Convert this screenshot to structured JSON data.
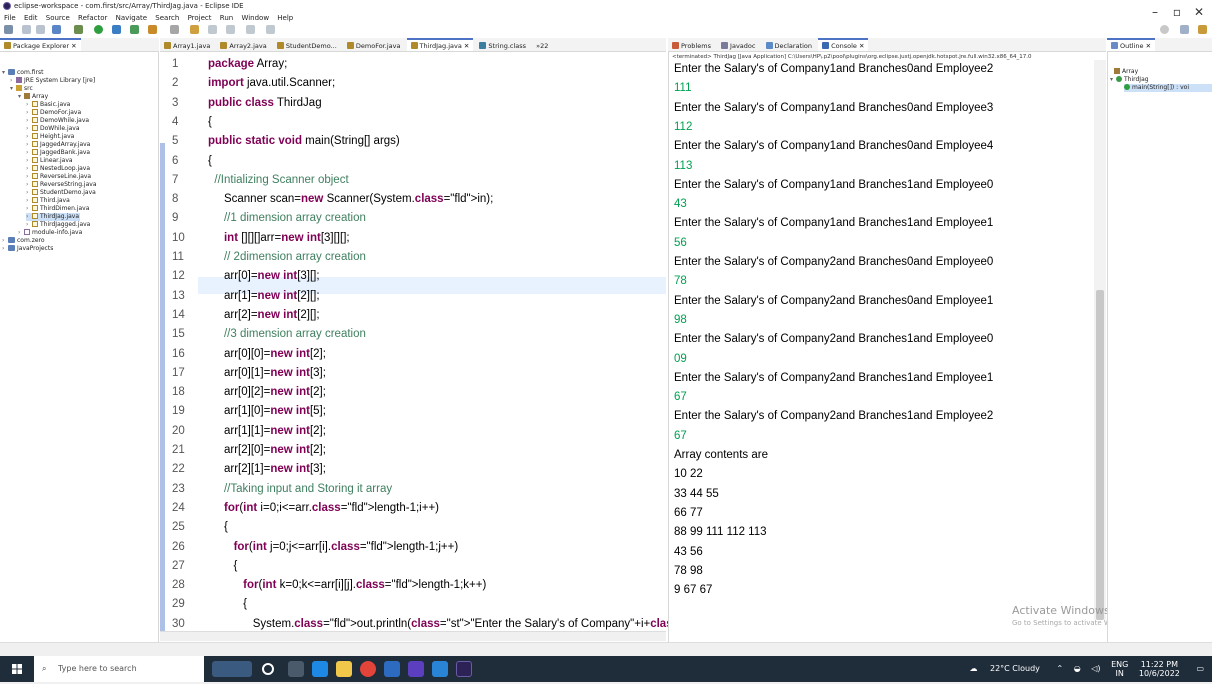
{
  "window": {
    "title": "eclipse-workspace - com.first/src/Array/ThirdJag.java - Eclipse IDE"
  },
  "menu": [
    "File",
    "Edit",
    "Source",
    "Refactor",
    "Navigate",
    "Search",
    "Project",
    "Run",
    "Window",
    "Help"
  ],
  "package_explorer": {
    "tab_label": "Package Explorer",
    "tree": [
      {
        "label": "com.first",
        "type": "project"
      },
      {
        "label": "JRE System Library [jre]",
        "type": "lib"
      },
      {
        "label": "src",
        "type": "folder"
      },
      {
        "label": "Array",
        "type": "package"
      },
      {
        "label": "Basic.java",
        "type": "file"
      },
      {
        "label": "DemoFor.java",
        "type": "file"
      },
      {
        "label": "DemoWhile.java",
        "type": "file"
      },
      {
        "label": "DoWhile.java",
        "type": "file"
      },
      {
        "label": "Height.java",
        "type": "file"
      },
      {
        "label": "JaggedArray.java",
        "type": "file"
      },
      {
        "label": "JaggedBank.java",
        "type": "file"
      },
      {
        "label": "Linear.java",
        "type": "file"
      },
      {
        "label": "NestedLoop.java",
        "type": "file"
      },
      {
        "label": "ReverseLine.java",
        "type": "file"
      },
      {
        "label": "ReverseString.java",
        "type": "file"
      },
      {
        "label": "StudentDemo.java",
        "type": "file"
      },
      {
        "label": "Third.java",
        "type": "file"
      },
      {
        "label": "ThirdDimen.java",
        "type": "file"
      },
      {
        "label": "ThirdJag.java",
        "type": "file"
      },
      {
        "label": "ThirdJagged.java",
        "type": "file"
      },
      {
        "label": "module-info.java",
        "type": "file"
      },
      {
        "label": "com.zero",
        "type": "project"
      },
      {
        "label": "JavaProjects",
        "type": "project"
      }
    ]
  },
  "editor": {
    "tabs": [
      "Array1.java",
      "Array2.java",
      "StudentDemo...",
      "DemoFor.java",
      "ThirdJag.java",
      "String.class"
    ],
    "overflow_count": "»22",
    "lines": [
      {
        "n": "1",
        "t": "package Array;"
      },
      {
        "n": "2",
        "t": "import java.util.Scanner;"
      },
      {
        "n": "3",
        "t": "public class ThirdJag"
      },
      {
        "n": "4",
        "t": "{"
      },
      {
        "n": "5",
        "t": "public static void main(String[] args)"
      },
      {
        "n": "6",
        "t": "{"
      },
      {
        "n": "7",
        "t": "  //Intializing Scanner object"
      },
      {
        "n": "8",
        "t": "     Scanner scan=new Scanner(System.in);"
      },
      {
        "n": "9",
        "t": "     //1 dimension array creation"
      },
      {
        "n": "10",
        "t": "     int [][][]arr=new int[3][][];"
      },
      {
        "n": "11",
        "t": "     // 2dimension array creation"
      },
      {
        "n": "12",
        "t": "     arr[0]=new int[3][];"
      },
      {
        "n": "13",
        "t": "     arr[1]=new int[2][];"
      },
      {
        "n": "14",
        "t": "     arr[2]=new int[2][];"
      },
      {
        "n": "15",
        "t": "     //3 dimension array creation"
      },
      {
        "n": "16",
        "t": "     arr[0][0]=new int[2];"
      },
      {
        "n": "17",
        "t": "     arr[0][1]=new int[3];"
      },
      {
        "n": "18",
        "t": "     arr[0][2]=new int[2];"
      },
      {
        "n": "19",
        "t": "     arr[1][0]=new int[5];"
      },
      {
        "n": "20",
        "t": "     arr[1][1]=new int[2];"
      },
      {
        "n": "21",
        "t": "     arr[2][0]=new int[2];"
      },
      {
        "n": "22",
        "t": "     arr[2][1]=new int[3];"
      },
      {
        "n": "23",
        "t": "     //Taking input and Storing it array"
      },
      {
        "n": "24",
        "t": "     for(int i=0;i<=arr.length-1;i++)"
      },
      {
        "n": "25",
        "t": "     {"
      },
      {
        "n": "26",
        "t": "        for(int j=0;j<=arr[i].length-1;j++)"
      },
      {
        "n": "27",
        "t": "        {"
      },
      {
        "n": "28",
        "t": "           for(int k=0;k<=arr[i][j].length-1;k++)"
      },
      {
        "n": "29",
        "t": "           {"
      },
      {
        "n": "30",
        "t": "              System.out.println(\"Enter the Salary's of Company\"+i+\"and Brc"
      }
    ]
  },
  "console": {
    "tabs": [
      "Problems",
      "Javadoc",
      "Declaration",
      "Console"
    ],
    "terminated": "<terminated> ThirdJag [Java Application] C:\\Users\\HP\\.p2\\pool\\plugins\\org.eclipse.justj.openjdk.hotspot.jre.full.win32.x86_64_17.0",
    "lines": [
      {
        "t": "Enter the Salary's of Company1and Branches0and Employee2",
        "k": "out"
      },
      {
        "t": "111",
        "k": "in"
      },
      {
        "t": "Enter the Salary's of Company1and Branches0and Employee3",
        "k": "out"
      },
      {
        "t": "112",
        "k": "in"
      },
      {
        "t": "Enter the Salary's of Company1and Branches0and Employee4",
        "k": "out"
      },
      {
        "t": "113",
        "k": "in"
      },
      {
        "t": "Enter the Salary's of Company1and Branches1and Employee0",
        "k": "out"
      },
      {
        "t": "43",
        "k": "in"
      },
      {
        "t": "Enter the Salary's of Company1and Branches1and Employee1",
        "k": "out"
      },
      {
        "t": "56",
        "k": "in"
      },
      {
        "t": "Enter the Salary's of Company2and Branches0and Employee0",
        "k": "out"
      },
      {
        "t": "78",
        "k": "in"
      },
      {
        "t": "Enter the Salary's of Company2and Branches0and Employee1",
        "k": "out"
      },
      {
        "t": "98",
        "k": "in"
      },
      {
        "t": "Enter the Salary's of Company2and Branches1and Employee0",
        "k": "out"
      },
      {
        "t": "09",
        "k": "in"
      },
      {
        "t": "Enter the Salary's of Company2and Branches1and Employee1",
        "k": "out"
      },
      {
        "t": "67",
        "k": "in"
      },
      {
        "t": "Enter the Salary's of Company2and Branches1and Employee2",
        "k": "out"
      },
      {
        "t": "67",
        "k": "in"
      },
      {
        "t": "Array contents are",
        "k": "out"
      },
      {
        "t": "10 22",
        "k": "out"
      },
      {
        "t": "33 44 55",
        "k": "out"
      },
      {
        "t": "66 77",
        "k": "out"
      },
      {
        "t": "88 99 111 112 113",
        "k": "out"
      },
      {
        "t": "43 56",
        "k": "out"
      },
      {
        "t": "78 98",
        "k": "out"
      },
      {
        "t": "9 67 67",
        "k": "out"
      }
    ],
    "watermark_title": "Activate Windows",
    "watermark_sub": "Go to Settings to activate Windows."
  },
  "outline": {
    "tab_label": "Outline",
    "items": [
      "Array",
      "ThirdJag",
      "main(String[]) : voi"
    ]
  },
  "taskbar": {
    "search_placeholder": "Type here to search",
    "weather": "22°C  Cloudy",
    "lang": "ENG",
    "region": "IN",
    "time": "11:22 PM",
    "date": "10/6/2022"
  }
}
